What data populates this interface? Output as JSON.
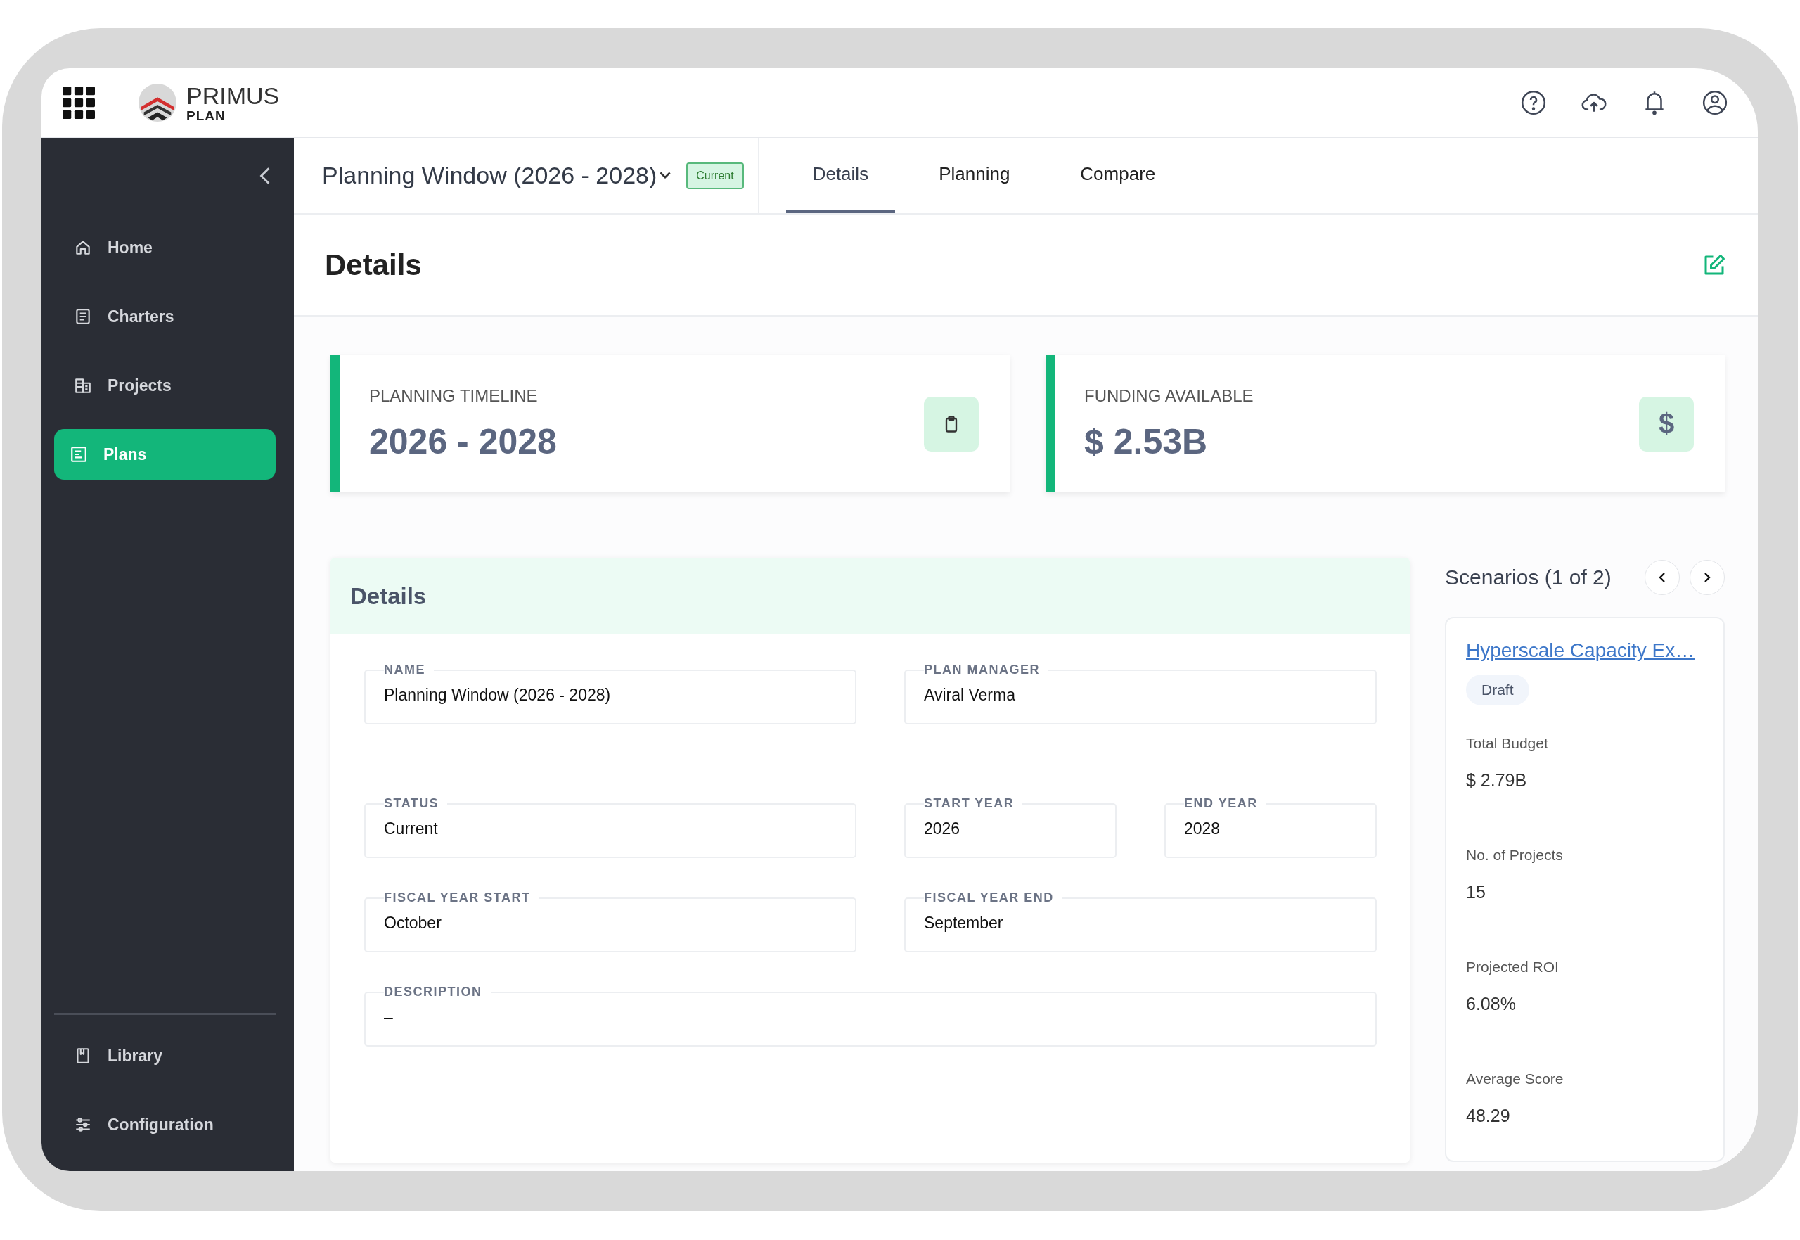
{
  "header": {
    "logo_title": "PRIMUS",
    "logo_subtitle": "PLAN"
  },
  "sidebar": {
    "items": [
      {
        "label": "Home",
        "selected": false
      },
      {
        "label": "Charters",
        "selected": false
      },
      {
        "label": "Projects",
        "selected": false
      },
      {
        "label": "Plans",
        "selected": true
      }
    ],
    "bottom_items": [
      {
        "label": "Library",
        "selected": false
      },
      {
        "label": "Configuration",
        "selected": false
      }
    ]
  },
  "plan_bar": {
    "title": "Planning Window (2026 - 2028)",
    "badge": "Current",
    "tabs": [
      {
        "label": "Details",
        "selected": true
      },
      {
        "label": "Planning",
        "selected": false
      },
      {
        "label": "Compare",
        "selected": false
      }
    ]
  },
  "page_title": "Details",
  "stat_cards": [
    {
      "label": "PLANNING TIMELINE",
      "value": "2026 - 2028"
    },
    {
      "label": "FUNDING AVAILABLE",
      "value": "$ 2.53B",
      "glyph": "$"
    }
  ],
  "details_panel": {
    "title": "Details",
    "rows": [
      [
        {
          "label": "NAME",
          "value": "Planning Window (2026 - 2028)"
        },
        {
          "label": "PLAN MANAGER",
          "value": "Aviral Verma"
        }
      ],
      [
        {
          "label": "STATUS",
          "value": "Current"
        },
        {
          "label": "START YEAR",
          "value": "2026"
        },
        {
          "label": "END YEAR",
          "value": "2028"
        }
      ],
      [
        {
          "label": "FISCAL YEAR START",
          "value": "October"
        },
        {
          "label": "FISCAL YEAR END",
          "value": "September"
        }
      ],
      [
        {
          "label": "DESCRIPTION",
          "value": "–"
        }
      ]
    ]
  },
  "scenarios": {
    "title": "Scenarios (1 of 2)",
    "card": {
      "name": "Hyperscale Capacity Ex…",
      "status": "Draft",
      "metrics": [
        {
          "label": "Total Budget",
          "value": "$ 2.79B"
        },
        {
          "label": "No. of Projects",
          "value": "15"
        },
        {
          "label": "Projected ROI",
          "value": "6.08%"
        },
        {
          "label": "Average Score",
          "value": "48.29"
        }
      ]
    }
  }
}
